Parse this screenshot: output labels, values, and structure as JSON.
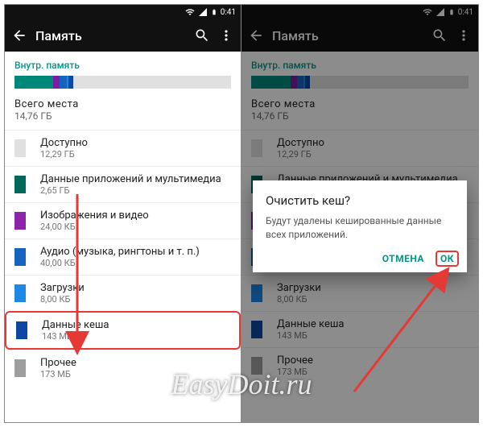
{
  "status": {
    "time": "0:41",
    "battery_icon": "battery",
    "signal_icon": "signal",
    "wifi_icon": "wifi"
  },
  "appbar": {
    "title": "Память",
    "back_icon": "arrow-back",
    "search_icon": "search",
    "overflow_icon": "more-vert"
  },
  "storage": {
    "section_label": "Внутр. память",
    "total_label": "Всего места",
    "total_value": "14,76 ГБ",
    "segments": [
      {
        "color": "#00897b",
        "pct": 18
      },
      {
        "color": "#7b1fa2",
        "pct": 3
      },
      {
        "color": "#1565c0",
        "pct": 3
      },
      {
        "color": "#1e88e5",
        "pct": 1
      },
      {
        "color": "#0d47a1",
        "pct": 2
      },
      {
        "color": "#e0e0e0",
        "pct": 73
      }
    ],
    "items": [
      {
        "label": "Доступно",
        "value": "12,29 ГБ",
        "color": "#e0e0e0"
      },
      {
        "label": "Данные приложений и мультимедиа",
        "value": "2,65 ГБ",
        "color": "#00695c"
      },
      {
        "label": "Изображения и видео",
        "value": "24,00 КБ",
        "color": "#8e24aa"
      },
      {
        "label": "Аудио (музыка, рингтоны и т. п.)",
        "value": "40,00 КБ",
        "color": "#1565c0"
      },
      {
        "label": "Загрузки",
        "value": "8,00 КБ",
        "color": "#1e88e5"
      },
      {
        "label": "Данные кеша",
        "value": "143 МБ",
        "color": "#0d47a1"
      },
      {
        "label": "Прочее",
        "value": "173 МБ",
        "color": "#9e9e9e"
      }
    ]
  },
  "dialog": {
    "title": "Очистить кеш?",
    "message": "Будут удалены кешированные данные всех приложений.",
    "cancel": "ОТМЕНА",
    "ok": "ОК"
  },
  "watermark": "EasyDoit.ru"
}
